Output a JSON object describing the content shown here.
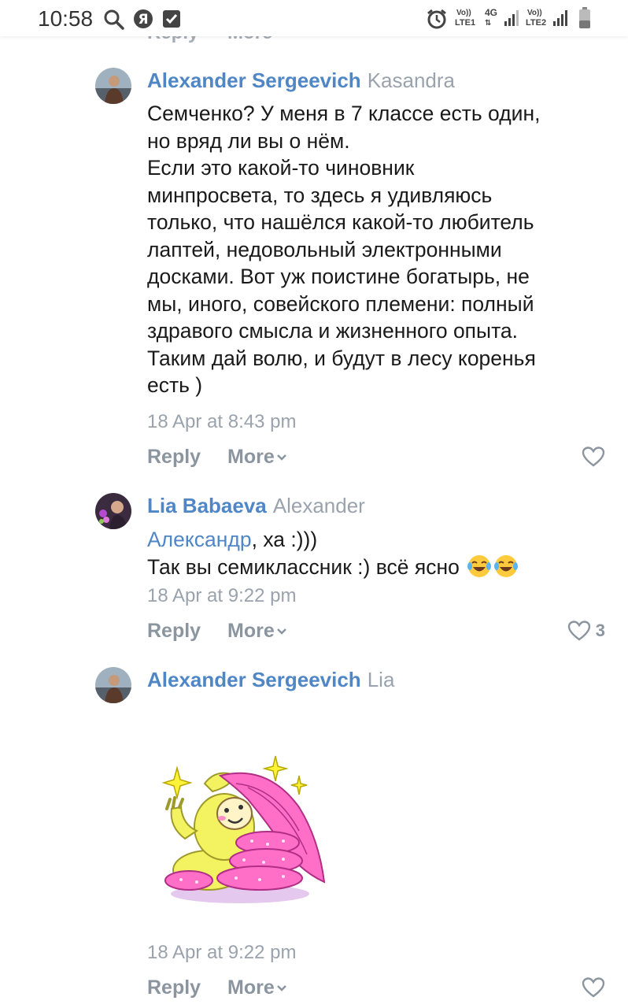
{
  "status_bar": {
    "time": "10:58",
    "sim1_label": "LTE1",
    "sim1_volte": "Vo))",
    "network_type": "4G",
    "sim2_label": "LTE2",
    "sim2_volte": "Vo))"
  },
  "prev_comment": {
    "reply_label": "Reply",
    "more_label": "More"
  },
  "comments": [
    {
      "author": "Alexander Sergeevich",
      "reply_to": "Kasandra",
      "text_lines": [
        "Семченко? У меня в 7 классе есть один,",
        "но вряд ли вы о нём.",
        "Если это какой-то чиновник",
        "минпросвета, то здесь я удивляюсь",
        "только, что нашёлся какой-то любитель",
        "лаптей, недовольный электронными",
        "досками. Вот уж поистине богатырь, не",
        "мы, иного, совейского племени: полный",
        "здравого смысла и жизненного опыта.",
        "Таким дай волю, и будут в лесу коренья",
        "есть )"
      ],
      "date": "18 Apr at 8:43 pm",
      "reply_label": "Reply",
      "more_label": "More",
      "likes": ""
    },
    {
      "author": "Lia Babaeva",
      "reply_to": "Alexander",
      "mention": "Александр",
      "text_line1_rest": ", ха :)))",
      "text_line2": "Так вы семиклассник :) всё ясно",
      "emoji": "😂😂",
      "date": "18 Apr at 9:22 pm",
      "reply_label": "Reply",
      "more_label": "More",
      "likes": "3"
    },
    {
      "author": "Alexander Sergeevich",
      "reply_to": "Lia",
      "sticker": "sticker-blanket-pillows",
      "date": "18 Apr at 9:22 pm",
      "reply_label": "Reply",
      "more_label": "More",
      "likes": ""
    }
  ],
  "colors": {
    "author": "#4f86c6",
    "secondary_text": "#9aa3ad",
    "action_text": "#8b95a0",
    "body_text": "#1a1a1a"
  }
}
